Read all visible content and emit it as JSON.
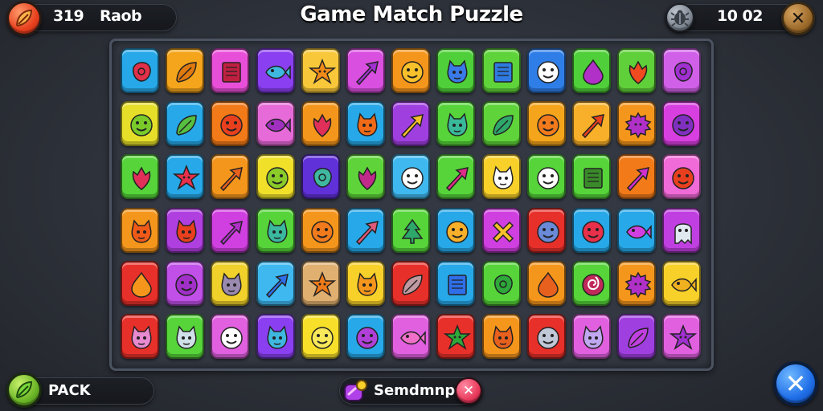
{
  "header": {
    "title": "Game Match Puzzle",
    "score": "319",
    "player_name": "Raob",
    "timer": "10 02",
    "close_label": "✕"
  },
  "footer": {
    "pack_label": "PACK",
    "powerup_label": "Semdmnp",
    "powerup_close_label": "✕",
    "exit_label": "✕"
  },
  "board": {
    "rows": [
      [
        {
          "color": "#27a8e8",
          "icon": "blob",
          "ink": "#e0304a"
        },
        {
          "color": "#f5a51c",
          "icon": "leaf",
          "ink": "#e07a10"
        },
        {
          "color": "#e84fd8",
          "icon": "square",
          "ink": "#c02040"
        },
        {
          "color": "#8a3ff0",
          "icon": "fish",
          "ink": "#3fb8e0"
        },
        {
          "color": "#f8c73a",
          "icon": "star",
          "ink": "#f08a18"
        },
        {
          "color": "#d94fe0",
          "icon": "arrow",
          "ink": "#a030d0"
        },
        {
          "color": "#f5961c",
          "icon": "face",
          "ink": "#f8c02a"
        },
        {
          "color": "#4fd03a",
          "icon": "monster",
          "ink": "#3a7ae8"
        },
        {
          "color": "#5fd43a",
          "icon": "square",
          "ink": "#2e7ae0"
        },
        {
          "color": "#2f7ee8",
          "icon": "face",
          "ink": "#ffffff"
        },
        {
          "color": "#4fcf3a",
          "icon": "drop",
          "ink": "#b030c8"
        },
        {
          "color": "#5fcf3a",
          "icon": "flower",
          "ink": "#f04a20"
        },
        {
          "color": "#d060e8",
          "icon": "blob",
          "ink": "#a030d0"
        }
      ],
      [
        {
          "color": "#e6df2a",
          "icon": "face",
          "ink": "#7acb2a"
        },
        {
          "color": "#27a8e8",
          "icon": "leaf",
          "ink": "#57c040"
        },
        {
          "color": "#f27a18",
          "icon": "face",
          "ink": "#e8401e"
        },
        {
          "color": "#e66ad8",
          "icon": "fish",
          "ink": "#a030c0"
        },
        {
          "color": "#f5961c",
          "icon": "flower",
          "ink": "#e0305a"
        },
        {
          "color": "#27a8e8",
          "icon": "monster",
          "ink": "#f06a18"
        },
        {
          "color": "#a03fe0",
          "icon": "arrow",
          "ink": "#f8c02a"
        },
        {
          "color": "#56d43a",
          "icon": "monster",
          "ink": "#3ab89a"
        },
        {
          "color": "#5fd43a",
          "icon": "leaf",
          "ink": "#2ea86a"
        },
        {
          "color": "#f5a51c",
          "icon": "face",
          "ink": "#f07a1c"
        },
        {
          "color": "#f8b02a",
          "icon": "arrow",
          "ink": "#e8401e"
        },
        {
          "color": "#f5961c",
          "icon": "gear",
          "ink": "#b030c8"
        },
        {
          "color": "#d83fe0",
          "icon": "face",
          "ink": "#8030c0"
        }
      ],
      [
        {
          "color": "#56d43a",
          "icon": "flower",
          "ink": "#e0305a"
        },
        {
          "color": "#27a8e8",
          "icon": "star",
          "ink": "#e8304a"
        },
        {
          "color": "#f5961c",
          "icon": "arrow",
          "ink": "#e8601e"
        },
        {
          "color": "#f0e02a",
          "icon": "face",
          "ink": "#8acb2a"
        },
        {
          "color": "#6030d8",
          "icon": "blob",
          "ink": "#3fb8a0"
        },
        {
          "color": "#5fd43a",
          "icon": "flower",
          "ink": "#c02a8a"
        },
        {
          "color": "#3fb8f0",
          "icon": "face",
          "ink": "#ffffff"
        },
        {
          "color": "#56d43a",
          "icon": "arrow",
          "ink": "#e02a8a"
        },
        {
          "color": "#f8d02a",
          "icon": "monster",
          "ink": "#ffffff"
        },
        {
          "color": "#56d43a",
          "icon": "face",
          "ink": "#ffffff"
        },
        {
          "color": "#56d43a",
          "icon": "square",
          "ink": "#3a8a2a"
        },
        {
          "color": "#f27a18",
          "icon": "arrow",
          "ink": "#d030d0"
        },
        {
          "color": "#f06ad8",
          "icon": "face",
          "ink": "#e8401e"
        }
      ],
      [
        {
          "color": "#f5961c",
          "icon": "monster",
          "ink": "#f05a18"
        },
        {
          "color": "#b03fe0",
          "icon": "monster",
          "ink": "#e8401e"
        },
        {
          "color": "#d03fe0",
          "icon": "arrow",
          "ink": "#b030c8"
        },
        {
          "color": "#56d43a",
          "icon": "monster",
          "ink": "#3ab8a0"
        },
        {
          "color": "#f5961c",
          "icon": "face",
          "ink": "#f07a1c"
        },
        {
          "color": "#27a8e8",
          "icon": "arrow",
          "ink": "#e05a7a"
        },
        {
          "color": "#56d43a",
          "icon": "tree",
          "ink": "#2ea86a"
        },
        {
          "color": "#27a8e8",
          "icon": "face",
          "ink": "#f8b02a"
        },
        {
          "color": "#d03fe0",
          "icon": "cross",
          "ink": "#f8c02a"
        },
        {
          "color": "#e8302a",
          "icon": "face",
          "ink": "#6a8ad8"
        },
        {
          "color": "#27a8e8",
          "icon": "face",
          "ink": "#e8304a"
        },
        {
          "color": "#27a8e8",
          "icon": "fish",
          "ink": "#d040e0"
        },
        {
          "color": "#c03fe0",
          "icon": "ghost",
          "ink": "#e0e8f0"
        }
      ],
      [
        {
          "color": "#e8302a",
          "icon": "drop",
          "ink": "#f5961c"
        },
        {
          "color": "#c050e8",
          "icon": "face",
          "ink": "#a030c8"
        },
        {
          "color": "#f0d02a",
          "icon": "monster",
          "ink": "#9a8ab0"
        },
        {
          "color": "#3fb8f0",
          "icon": "arrow",
          "ink": "#2f6ee8"
        },
        {
          "color": "#e0b070",
          "icon": "star",
          "ink": "#f07a18"
        },
        {
          "color": "#f8d02a",
          "icon": "monster",
          "ink": "#f5961c"
        },
        {
          "color": "#e8302a",
          "icon": "leaf",
          "ink": "#c09aa0"
        },
        {
          "color": "#27a8e8",
          "icon": "square",
          "ink": "#2f6ee8"
        },
        {
          "color": "#56d43a",
          "icon": "blob",
          "ink": "#2ea83a"
        },
        {
          "color": "#f5961c",
          "icon": "drop",
          "ink": "#e8601e"
        },
        {
          "color": "#56d43a",
          "icon": "swirl",
          "ink": "#c02a5a"
        },
        {
          "color": "#f5961c",
          "icon": "gear",
          "ink": "#b030c8"
        },
        {
          "color": "#f8d02a",
          "icon": "fish",
          "ink": "#f0b020"
        }
      ],
      [
        {
          "color": "#e8302a",
          "icon": "monster",
          "ink": "#e88ad0"
        },
        {
          "color": "#56d43a",
          "icon": "monster",
          "ink": "#d0e0e8"
        },
        {
          "color": "#e060e0",
          "icon": "face",
          "ink": "#ffffff"
        },
        {
          "color": "#8a3ff0",
          "icon": "monster",
          "ink": "#3fb8e0"
        },
        {
          "color": "#f8e02a",
          "icon": "face",
          "ink": "#f8e85a"
        },
        {
          "color": "#27a8e8",
          "icon": "face",
          "ink": "#b040d8"
        },
        {
          "color": "#e060e0",
          "icon": "fish",
          "ink": "#f070c8"
        },
        {
          "color": "#e8302a",
          "icon": "star",
          "ink": "#2ea83a"
        },
        {
          "color": "#f5961c",
          "icon": "monster",
          "ink": "#e8601e"
        },
        {
          "color": "#e8302a",
          "icon": "face",
          "ink": "#c0c8d8"
        },
        {
          "color": "#e060e0",
          "icon": "monster",
          "ink": "#c0a8f0"
        },
        {
          "color": "#a03fe0",
          "icon": "leaf",
          "ink": "#c040e0"
        },
        {
          "color": "#e060e0",
          "icon": "star",
          "ink": "#a030d0"
        }
      ]
    ]
  }
}
